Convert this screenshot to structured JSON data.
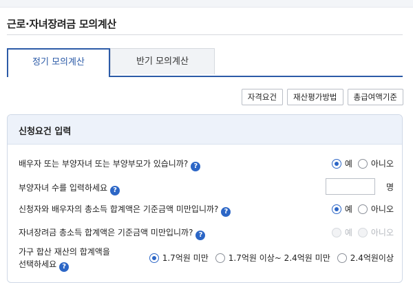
{
  "page": {
    "title": "근로·자녀장려금 모의계산"
  },
  "tabs": [
    {
      "label": "정기 모의계산",
      "active": true
    },
    {
      "label": "반기 모의계산",
      "active": false
    }
  ],
  "buttons": {
    "eligibility": "자격요건",
    "asset_method": "재산평가방법",
    "total_pay_criteria": "총급여액기준"
  },
  "panel": {
    "title": "신청요건 입력",
    "questions": {
      "q1": {
        "text": "배우자 또는 부양자녀 또는 부양부모가 있습니까?",
        "options": [
          "예",
          "아니오"
        ],
        "selected": "예"
      },
      "q2": {
        "text": "부양자녀 수를 입력하세요",
        "value": "",
        "unit": "명"
      },
      "q3": {
        "text": "신청자와 배우자의 총소득 합계액은 기준금액 미만입니까?",
        "options": [
          "예",
          "아니오"
        ],
        "selected": "예"
      },
      "q4": {
        "text": "자녀장려금 총소득 합계액은 기준금액 미만입니까?",
        "options": [
          "예",
          "아니오"
        ],
        "selected": null,
        "disabled": true
      },
      "q5": {
        "text_line1": "가구 합산 재산의 합계액을",
        "text_line2": "선택하세요",
        "options": [
          "1.7억원 미만",
          "1.7억원 이상~ 2.4억원 미만",
          "2.4억원이상"
        ],
        "selected": "1.7억원 미만"
      }
    },
    "help_glyph": "?"
  },
  "colors": {
    "accent": "#2b5aa7",
    "help": "#2c66c6",
    "panel_header_bg": "#edf2fa"
  }
}
